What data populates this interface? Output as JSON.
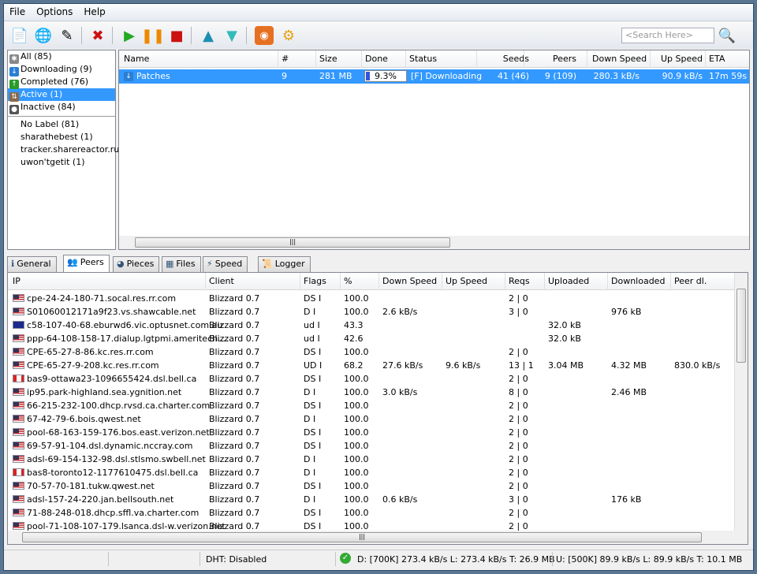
{
  "menu": [
    "File",
    "Options",
    "Help"
  ],
  "toolbar": {
    "icons": [
      "add-torrent-icon",
      "add-url-icon",
      "create-torrent-icon",
      "remove-icon",
      "start-icon",
      "pause-icon",
      "stop-icon",
      "move-up-icon",
      "move-down-icon",
      "rss-icon",
      "preferences-icon"
    ],
    "search_placeholder": "<Search Here>"
  },
  "categories": [
    {
      "label": "All (85)",
      "icon": "all-icon",
      "color": "#888"
    },
    {
      "label": "Downloading (9)",
      "icon": "downloading-icon",
      "color": "#2a7fd4"
    },
    {
      "label": "Completed (76)",
      "icon": "completed-icon",
      "color": "#2a9a2a"
    },
    {
      "label": "Active (1)",
      "icon": "active-icon",
      "color": "#8a6a4a",
      "selected": true
    },
    {
      "label": "Inactive (84)",
      "icon": "inactive-icon",
      "color": "#555"
    }
  ],
  "labels": [
    "No Label (81)",
    "sharathebest (1)",
    "tracker.sharereactor.ru",
    "uwon'tgetit (1)"
  ],
  "torrents": {
    "columns": [
      "Name",
      "#",
      "Size",
      "Done",
      "Status",
      "Seeds",
      "Peers",
      "Down Speed",
      "Up Speed",
      "ETA"
    ],
    "rows": [
      {
        "name": "Patches",
        "num": "9",
        "size": "281 MB",
        "done": "9.3%",
        "done_pct": 9.3,
        "status": "[F] Downloading",
        "seeds": "41 (46)",
        "peers": "9 (109)",
        "down": "280.3 kB/s",
        "up": "90.9 kB/s",
        "eta": "17m 59s"
      }
    ]
  },
  "tabs": [
    "General",
    "Peers",
    "Pieces",
    "Files",
    "Speed",
    "Logger"
  ],
  "active_tab": "Peers",
  "peers": {
    "columns": [
      "IP",
      "Client",
      "Flags",
      "%",
      "Down Speed",
      "Up Speed",
      "Reqs",
      "Uploaded",
      "Downloaded",
      "Peer dl."
    ],
    "rows": [
      [
        "us",
        "cpe-24-24-180-71.socal.res.rr.com",
        "Blizzard 0.7",
        "DS I",
        "100.0",
        "",
        "",
        "2 | 0",
        "",
        "",
        ""
      ],
      [
        "us",
        "S01060012171a9f23.vs.shawcable.net",
        "Blizzard 0.7",
        "D I",
        "100.0",
        "2.6 kB/s",
        "",
        "3 | 0",
        "",
        "976 kB",
        ""
      ],
      [
        "au",
        "c58-107-40-68.eburwd6.vic.optusnet.com.au",
        "Blizzard 0.7",
        "ud I",
        "43.3",
        "",
        "",
        "",
        "32.0 kB",
        "",
        ""
      ],
      [
        "us",
        "ppp-64-108-158-17.dialup.lgtpmi.ameritech....",
        "Blizzard 0.7",
        "ud I",
        "42.6",
        "",
        "",
        "",
        "32.0 kB",
        "",
        ""
      ],
      [
        "us",
        "CPE-65-27-8-86.kc.res.rr.com",
        "Blizzard 0.7",
        "DS I",
        "100.0",
        "",
        "",
        "2 | 0",
        "",
        "",
        ""
      ],
      [
        "us",
        "CPE-65-27-9-208.kc.res.rr.com",
        "Blizzard 0.7",
        "UD I",
        "68.2",
        "27.6 kB/s",
        "9.6 kB/s",
        "13 | 1",
        "3.04 MB",
        "4.32 MB",
        "830.0 kB/s"
      ],
      [
        "ca",
        "bas9-ottawa23-1096655424.dsl.bell.ca",
        "Blizzard 0.7",
        "DS I",
        "100.0",
        "",
        "",
        "2 | 0",
        "",
        "",
        ""
      ],
      [
        "us",
        "ip95.park-highland.sea.ygnition.net",
        "Blizzard 0.7",
        "D I",
        "100.0",
        "3.0 kB/s",
        "",
        "8 | 0",
        "",
        "2.46 MB",
        ""
      ],
      [
        "us",
        "66-215-232-100.dhcp.rvsd.ca.charter.com",
        "Blizzard 0.7",
        "DS I",
        "100.0",
        "",
        "",
        "2 | 0",
        "",
        "",
        ""
      ],
      [
        "us",
        "67-42-79-6.bois.qwest.net",
        "Blizzard 0.7",
        "D I",
        "100.0",
        "",
        "",
        "2 | 0",
        "",
        "",
        ""
      ],
      [
        "us",
        "pool-68-163-159-176.bos.east.verizon.net",
        "Blizzard 0.7",
        "DS I",
        "100.0",
        "",
        "",
        "2 | 0",
        "",
        "",
        ""
      ],
      [
        "us",
        "69-57-91-104.dsl.dynamic.nccray.com",
        "Blizzard 0.7",
        "DS I",
        "100.0",
        "",
        "",
        "2 | 0",
        "",
        "",
        ""
      ],
      [
        "us",
        "adsl-69-154-132-98.dsl.stlsmo.swbell.net",
        "Blizzard 0.7",
        "D I",
        "100.0",
        "",
        "",
        "2 | 0",
        "",
        "",
        ""
      ],
      [
        "ca",
        "bas8-toronto12-1177610475.dsl.bell.ca",
        "Blizzard 0.7",
        "D I",
        "100.0",
        "",
        "",
        "2 | 0",
        "",
        "",
        ""
      ],
      [
        "us",
        "70-57-70-181.tukw.qwest.net",
        "Blizzard 0.7",
        "DS I",
        "100.0",
        "",
        "",
        "2 | 0",
        "",
        "",
        ""
      ],
      [
        "us",
        "adsl-157-24-220.jan.bellsouth.net",
        "Blizzard 0.7",
        "D I",
        "100.0",
        "0.6 kB/s",
        "",
        "3 | 0",
        "",
        "176 kB",
        ""
      ],
      [
        "us",
        "71-88-248-018.dhcp.sffl.va.charter.com",
        "Blizzard 0.7",
        "DS I",
        "100.0",
        "",
        "",
        "2 | 0",
        "",
        "",
        ""
      ],
      [
        "us",
        "pool-71-108-107-179.lsanca.dsl-w.verizon.net",
        "Blizzard 0.7",
        "DS I",
        "100.0",
        "",
        "",
        "2 | 0",
        "",
        "",
        ""
      ]
    ]
  },
  "status": {
    "dht": "DHT: Disabled",
    "download": "D:  [700K] 273.4 kB/s L: 273.4 kB/s T: 26.9 MB",
    "upload": "U:  [500K] 89.9 kB/s L: 89.9 kB/s T: 10.1 MB"
  }
}
